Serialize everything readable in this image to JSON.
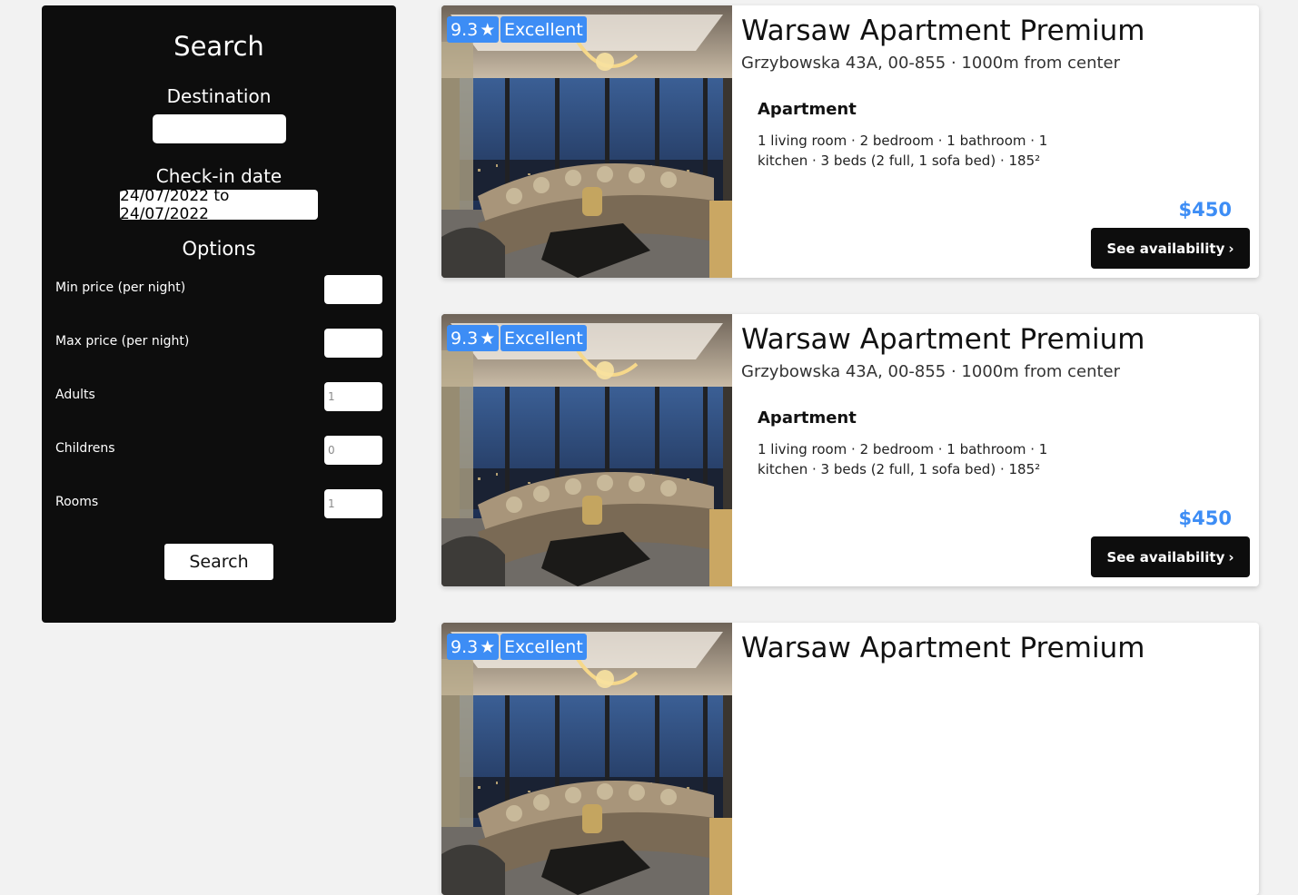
{
  "search": {
    "title": "Search",
    "destination_label": "Destination",
    "destination_value": "",
    "checkin_label": "Check-in date",
    "checkin_value": "24/07/2022 to 24/07/2022",
    "options_title": "Options",
    "options": [
      {
        "label": "Min price (per night)",
        "value": ""
      },
      {
        "label": "Max price (per night)",
        "value": ""
      },
      {
        "label": "Adults",
        "value": "1"
      },
      {
        "label": "Childrens",
        "value": "0"
      },
      {
        "label": "Rooms",
        "value": "1"
      }
    ],
    "button_label": "Search"
  },
  "results": [
    {
      "score": "9.3",
      "score_icon": "star-icon",
      "rating_text": "Excellent",
      "title": "Warsaw Apartment Premium",
      "address": "Grzybowska 43A, 00-855 · 1000m from center",
      "type": "Apartment",
      "description": "1 living room · 2 bedroom · 1 bathroom · 1 kitchen · 3 beds (2 full, 1 sofa bed) · 185²",
      "price": "$450",
      "button_label": "See availability",
      "button_icon": "chevron-right-icon"
    },
    {
      "score": "9.3",
      "score_icon": "star-icon",
      "rating_text": "Excellent",
      "title": "Warsaw Apartment Premium",
      "address": "Grzybowska 43A, 00-855 · 1000m from center",
      "type": "Apartment",
      "description": "1 living room · 2 bedroom · 1 bathroom · 1 kitchen · 3 beds (2 full, 1 sofa bed) · 185²",
      "price": "$450",
      "button_label": "See availability",
      "button_icon": "chevron-right-icon"
    },
    {
      "score": "9.3",
      "score_icon": "star-icon",
      "rating_text": "Excellent",
      "title": "Warsaw Apartment Premium"
    }
  ],
  "colors": {
    "accent": "#3d8df5",
    "sidebar_bg": "#0d0d0d",
    "page_bg": "#f2f2f2"
  }
}
